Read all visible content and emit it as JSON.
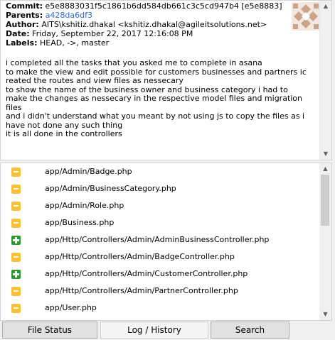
{
  "commit": {
    "commit_label": "Commit:",
    "commit_value": "e5e8883031f5c1861b6dd584db661c3c5cd947b4 [e5e8883]",
    "parents_label": "Parents:",
    "parents_value": "a428da6df3",
    "author_label": "Author:",
    "author_value": "AITS\\kshitiz.dhakal <kshitiz.dhakal@agileitsolutions.net>",
    "date_label": "Date:",
    "date_value": "Friday, September 22, 2017 12:16:08 PM",
    "labels_label": "Labels:",
    "labels_value": "HEAD, ->, master",
    "message": "i completed all the tasks that you asked me to complete in asana\nto make the view and edit possible for customers businesses and partners ic\nreated the routes and view files as nessecary\nto show the name of the business owner and business category i had to\nmake the changes as nessecary in the respective model files and migration\nfiles\nand i didn't understand what you meant by not using js to copy the files as i\nhave not done any such thing\nit is all done in the controllers",
    "link_color": "#2f6bd6"
  },
  "files": [
    {
      "status": "modified",
      "path": "app/Admin/Badge.php"
    },
    {
      "status": "modified",
      "path": "app/Admin/BusinessCategory.php"
    },
    {
      "status": "modified",
      "path": "app/Admin/Role.php"
    },
    {
      "status": "modified",
      "path": "app/Business.php"
    },
    {
      "status": "added",
      "path": "app/Http/Controllers/Admin/AdminBusinessController.php"
    },
    {
      "status": "modified",
      "path": "app/Http/Controllers/Admin/BadgeController.php"
    },
    {
      "status": "added",
      "path": "app/Http/Controllers/Admin/CustomerController.php"
    },
    {
      "status": "modified",
      "path": "app/Http/Controllers/Admin/PartnerController.php"
    },
    {
      "status": "modified",
      "path": "app/User.php"
    },
    {
      "status": "modified",
      "path": ""
    }
  ],
  "status_colors": {
    "modified": "#f7c23a",
    "added": "#2d9a2d"
  },
  "tabs": [
    {
      "label": "File Status",
      "active": false
    },
    {
      "label": "Log / History",
      "active": true
    },
    {
      "label": "Search",
      "active": false
    }
  ]
}
